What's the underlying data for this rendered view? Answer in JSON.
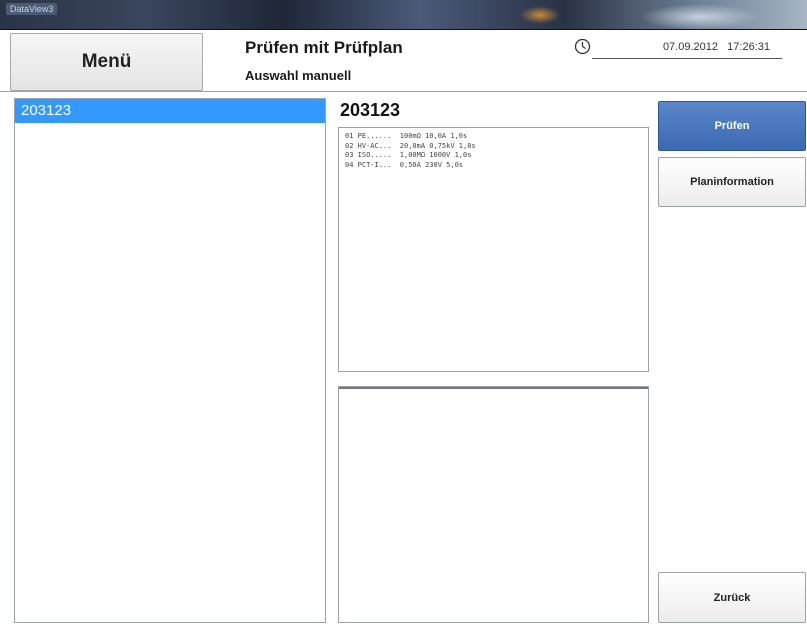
{
  "window": {
    "title": "DataView3"
  },
  "header": {
    "menu_label": "Menü",
    "title": "Prüfen mit Prüfplan",
    "subtitle": "Auswahl manuell",
    "date": "07.09.2012",
    "time": "17:26:31"
  },
  "list": {
    "items": [
      {
        "label": "203123",
        "selected": true
      }
    ]
  },
  "plan": {
    "title": "203123",
    "lines": [
      "01 PE......  100mΩ 10,0A 1,0s",
      "02 HV-AC...  20,0mA 0,75kV 1,0s",
      "03 ISO.....  1,00MΩ 1000V 1,0s",
      "04 PCT-I...  0,50A 230V 5,0s"
    ]
  },
  "buttons": {
    "pruefen": "Prüfen",
    "planinformation": "Planinformation",
    "zurueck": "Zurück"
  },
  "colors": {
    "selection": "#3399ff",
    "primary_button": "#3c69b2"
  },
  "icons": {
    "clock": "clock-icon"
  }
}
